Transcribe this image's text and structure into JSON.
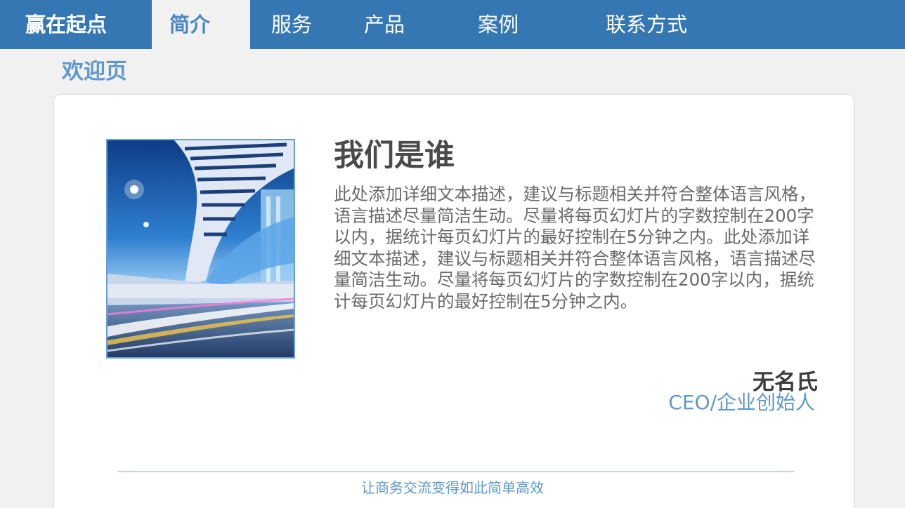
{
  "nav": {
    "brand": "赢在起点",
    "items": [
      {
        "label": "简介",
        "active": true
      },
      {
        "label": "服务",
        "active": false
      },
      {
        "label": "产品",
        "active": false
      },
      {
        "label": "案例",
        "active": false
      },
      {
        "label": "联系方式",
        "active": false
      }
    ]
  },
  "page": {
    "heading": "欢迎页"
  },
  "content": {
    "title": "我们是谁",
    "body": "此处添加详细文本描述，建议与标题相关并符合整体语言风格，语言描述尽量简洁生动。尽量将每页幻灯片的字数控制在200字以内，据统计每页幻灯片的最好控制在5分钟之内。此处添加详细文本描述，建议与标题相关并符合整体语言风格，语言描述尽量简洁生动。尽量将每页幻灯片的字数控制在200字以内，据统计每页幻灯片的最好控制在5分钟之内。",
    "author_name": "无名氏",
    "author_title": "CEO/企业创始人"
  },
  "footer": {
    "tagline": "让商务交流变得如此简单高效"
  },
  "colors": {
    "nav_bg": "#3577b3",
    "accent": "#5e98cc",
    "page_bg": "#f1f1f1"
  }
}
